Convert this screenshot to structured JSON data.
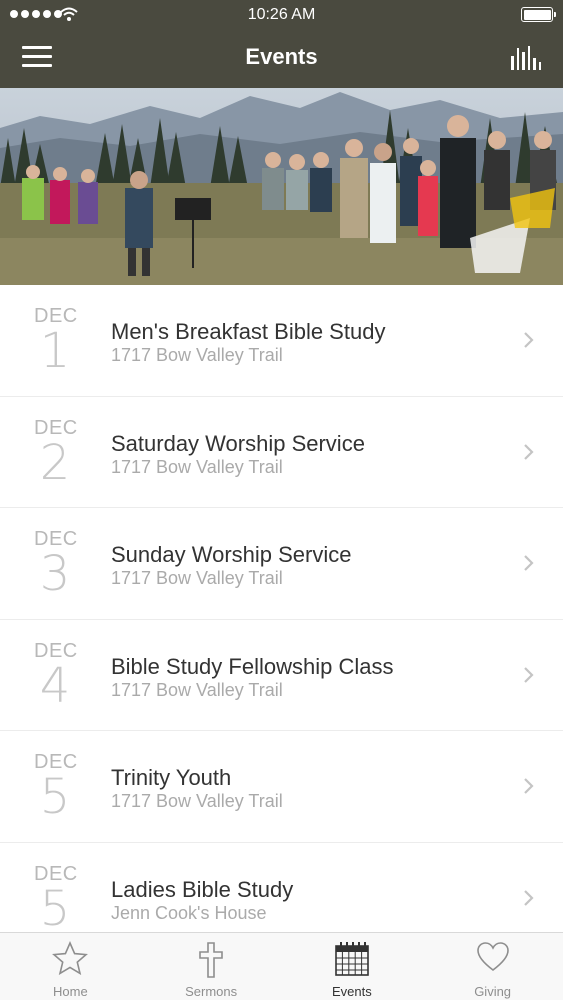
{
  "status_bar": {
    "time": "10:26 AM"
  },
  "header": {
    "title": "Events"
  },
  "events": [
    {
      "month": "DEC",
      "day": "1",
      "title": "Men's Breakfast Bible Study",
      "location": "1717 Bow Valley Trail"
    },
    {
      "month": "DEC",
      "day": "2",
      "title": "Saturday Worship Service",
      "location": "1717 Bow Valley Trail"
    },
    {
      "month": "DEC",
      "day": "3",
      "title": "Sunday Worship Service",
      "location": "1717 Bow Valley Trail"
    },
    {
      "month": "DEC",
      "day": "4",
      "title": "Bible Study Fellowship Class",
      "location": "1717 Bow Valley Trail"
    },
    {
      "month": "DEC",
      "day": "5",
      "title": "Trinity Youth",
      "location": "1717 Bow Valley Trail"
    },
    {
      "month": "DEC",
      "day": "5",
      "title": "Ladies Bible Study",
      "location": "Jenn Cook's House"
    }
  ],
  "tabs": [
    {
      "label": "Home",
      "icon": "star-icon"
    },
    {
      "label": "Sermons",
      "icon": "cross-icon"
    },
    {
      "label": "Events",
      "icon": "calendar-icon",
      "active": true
    },
    {
      "label": "Giving",
      "icon": "heart-icon"
    }
  ],
  "colors": {
    "header_bg": "#4a4a3f",
    "tab_active": "#333333",
    "tab_inactive": "#8e8e8e"
  }
}
